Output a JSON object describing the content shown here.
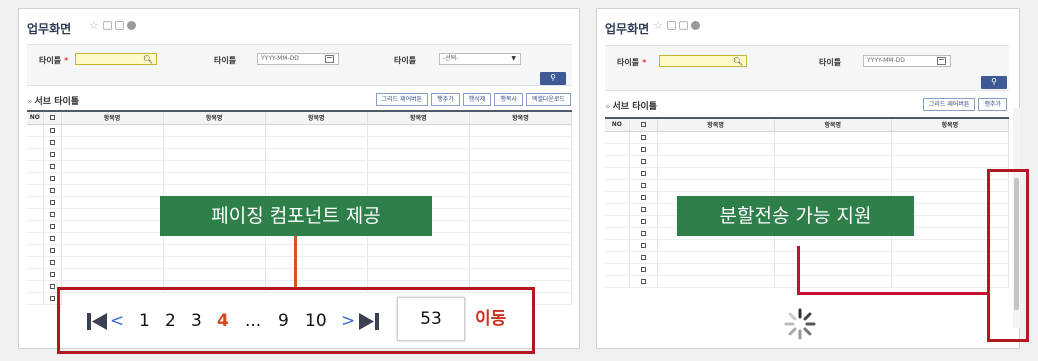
{
  "left_panel": {
    "title": "업무화면",
    "search": {
      "field1_label": "타이틀",
      "required_mark": "*",
      "field2_label": "타이틀",
      "date_placeholder": "YYYY-MM-DD",
      "field3_label": "타이틀",
      "select_value": "-선택-"
    },
    "subtitle": "서브 타이틀",
    "grid_buttons": [
      "그리드 제어버튼",
      "행추가",
      "행삭제",
      "행복사",
      "엑셀다운로드"
    ],
    "columns": [
      "NO",
      "",
      "항목명",
      "항목명",
      "항목명",
      "항목명",
      "항목명"
    ],
    "row_count": 15,
    "callout": "페이징 컴포넌트 제공"
  },
  "pager": {
    "prev": "<",
    "pages": [
      "1",
      "2",
      "3",
      "4",
      "...",
      "9",
      "10"
    ],
    "current": "4",
    "next": ">",
    "goto_value": "53",
    "goto_label": "이동",
    "icons": [
      "first-page-icon",
      "last-page-icon"
    ]
  },
  "right_panel": {
    "title": "업무화면",
    "search": {
      "field1_label": "타이틀",
      "required_mark": "*",
      "field2_label": "타이틀",
      "date_placeholder": "YYYY-MM-DD"
    },
    "subtitle": "서브 타이틀",
    "grid_buttons": [
      "그리드 제어버튼",
      "행추가"
    ],
    "columns": [
      "NO",
      "",
      "항목명",
      "항목명",
      "항목명"
    ],
    "row_count": 13,
    "callout": "분할전송 가능 지원"
  },
  "colors": {
    "accent_red": "#b3171f",
    "callout_green": "#2f7f4b",
    "search_button": "#3d5a95",
    "current_page": "#d04a1f"
  }
}
